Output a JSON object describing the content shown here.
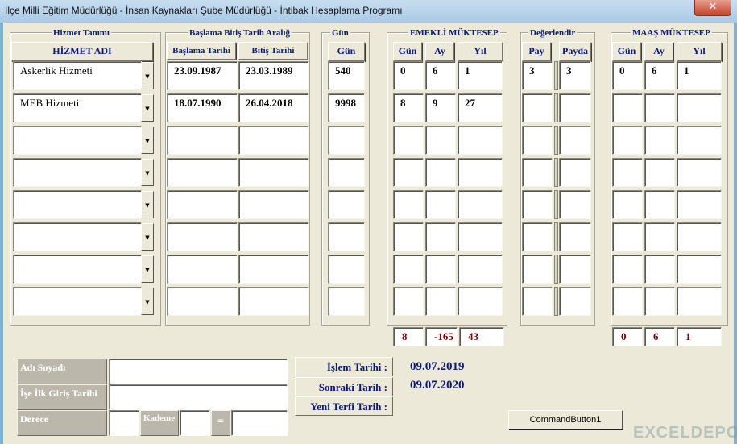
{
  "window": {
    "title": "İlçe Milli Eğitim Müdürlüğü - İnsan Kaynakları Şube Müdürlüğü - İntibak Hesaplama Programı",
    "close_glyph": "✕"
  },
  "groups": {
    "hizmet": "Hizmet Tanımı",
    "tarih": "Başlama Bitiş Tarih Aralığ",
    "gun": "Gün",
    "emekli": "EMEKLİ MÜKTESEP",
    "deger": "Değerlendir",
    "maas": "MAAŞ MÜKTESEP"
  },
  "headers": {
    "hizmet_adi": "HİZMET ADI",
    "baslama": "Başlama Tarihi",
    "bitis": "Bitiş Tarihi",
    "gun": "Gün",
    "e_gun": "Gün",
    "e_ay": "Ay",
    "e_yil": "Yıl",
    "pay": "Pay",
    "payda": "Payda",
    "m_gun": "Gün",
    "m_ay": "Ay",
    "m_yil": "Yıl"
  },
  "rows": [
    {
      "name": "Askerlik Hizmeti",
      "start": "23.09.1987",
      "end": "23.03.1989",
      "days": "540",
      "e_gun": "0",
      "e_ay": "6",
      "e_yil": "1",
      "pay": "3",
      "payda": "3",
      "m_gun": "0",
      "m_ay": "6",
      "m_yil": "1"
    },
    {
      "name": "MEB Hizmeti",
      "start": "18.07.1990",
      "end": "26.04.2018",
      "days": "9998",
      "e_gun": "8",
      "e_ay": "9",
      "e_yil": "27",
      "pay": "",
      "payda": "",
      "m_gun": "",
      "m_ay": "",
      "m_yil": ""
    },
    {
      "name": "",
      "start": "",
      "end": "",
      "days": "",
      "e_gun": "",
      "e_ay": "",
      "e_yil": "",
      "pay": "",
      "payda": "",
      "m_gun": "",
      "m_ay": "",
      "m_yil": ""
    },
    {
      "name": "",
      "start": "",
      "end": "",
      "days": "",
      "e_gun": "",
      "e_ay": "",
      "e_yil": "",
      "pay": "",
      "payda": "",
      "m_gun": "",
      "m_ay": "",
      "m_yil": ""
    },
    {
      "name": "",
      "start": "",
      "end": "",
      "days": "",
      "e_gun": "",
      "e_ay": "",
      "e_yil": "",
      "pay": "",
      "payda": "",
      "m_gun": "",
      "m_ay": "",
      "m_yil": ""
    },
    {
      "name": "",
      "start": "",
      "end": "",
      "days": "",
      "e_gun": "",
      "e_ay": "",
      "e_yil": "",
      "pay": "",
      "payda": "",
      "m_gun": "",
      "m_ay": "",
      "m_yil": ""
    },
    {
      "name": "",
      "start": "",
      "end": "",
      "days": "",
      "e_gun": "",
      "e_ay": "",
      "e_yil": "",
      "pay": "",
      "payda": "",
      "m_gun": "",
      "m_ay": "",
      "m_yil": ""
    },
    {
      "name": "",
      "start": "",
      "end": "",
      "days": "",
      "e_gun": "",
      "e_ay": "",
      "e_yil": "",
      "pay": "",
      "payda": "",
      "m_gun": "",
      "m_ay": "",
      "m_yil": ""
    }
  ],
  "totals": {
    "e_gun": "8",
    "e_ay": "-165",
    "e_yil": "43",
    "m_gun": "0",
    "m_ay": "6",
    "m_yil": "1"
  },
  "person": {
    "adi_soyadi": "Adı Soyadı",
    "ise_giris": "İşe İlk Giriş Tarihi",
    "derece": "Derece",
    "kademe": "Kademe",
    "equals": "="
  },
  "dates": {
    "islem_label": "İşlem Tarihi :",
    "islem_value": "09.07.2019",
    "sonraki_label": "Sonraki Tarih :",
    "sonraki_value": "09.07.2020",
    "terfi_label": "Yeni Terfi Tarih :",
    "terfi_value": ""
  },
  "command_button": "CommandButton1",
  "watermark": "EXCELDEPO"
}
